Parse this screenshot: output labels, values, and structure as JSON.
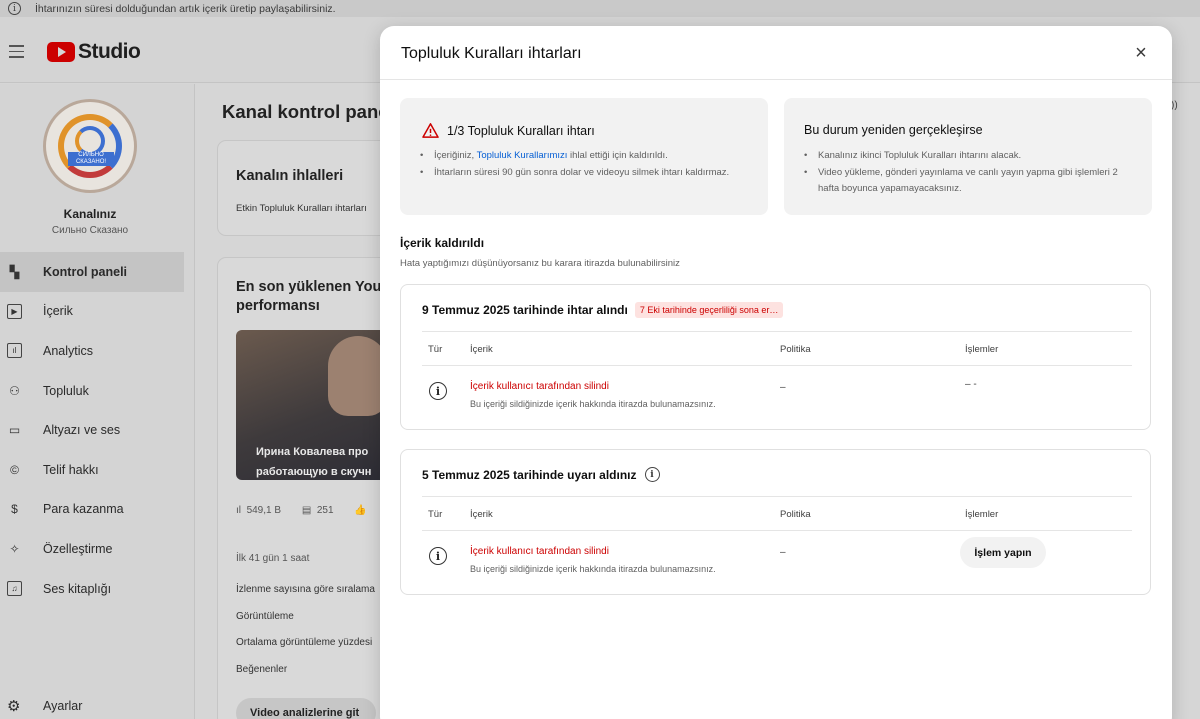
{
  "banner": {
    "info_icon": "i",
    "text": "İhtarınızın süresi dolduğundan artık içerik üretip paylaşabilirsiniz."
  },
  "header": {
    "logo_text": "Studio",
    "brand_color": "#cc0000"
  },
  "channel": {
    "name": "Kanalınız",
    "subtitle": "Сильно Сказано",
    "avatar_text": "СИЛЬНО СКАЗАНО!"
  },
  "sidebar": {
    "items": [
      {
        "label": "Kontrol paneli",
        "icon": "dashboard-icon",
        "glyph": "▚",
        "active": true
      },
      {
        "label": "İçerik",
        "icon": "content-icon",
        "glyph": "▶"
      },
      {
        "label": "Analytics",
        "icon": "analytics-icon",
        "glyph": "ıl"
      },
      {
        "label": "Topluluk",
        "icon": "community-icon",
        "glyph": "⚇"
      },
      {
        "label": "Altyazı ve ses",
        "icon": "subtitles-icon",
        "glyph": "▭"
      },
      {
        "label": "Telif hakkı",
        "icon": "copyright-icon",
        "glyph": "©"
      },
      {
        "label": "Para kazanma",
        "icon": "monetization-icon",
        "glyph": "$"
      },
      {
        "label": "Özelleştirme",
        "icon": "customization-icon",
        "glyph": "✧"
      },
      {
        "label": "Ses kitaplığı",
        "icon": "audio-library-icon",
        "glyph": "♫"
      }
    ],
    "settings": {
      "label": "Ayarlar",
      "icon": "settings-icon",
      "glyph": "⚙"
    }
  },
  "main": {
    "title": "Kanal kontrol paneli",
    "violations_card": {
      "title": "Kanalın ihlalleri",
      "text": "Etkin Topluluk Kuralları ihtarları"
    },
    "latest_card": {
      "title_line1": "En son yüklenen YouTube video",
      "title_line2": "performansı",
      "video_caption_line1": "Ирина Ковалева про",
      "video_caption_line2": "работающую в скучн",
      "stats": {
        "views": "549,1 B",
        "comments": "251"
      },
      "meta": "İlk 41 gün 1 saat",
      "rows": [
        "İzlenme sayısına göre sıralama",
        "Görüntüleme",
        "Ortalama görüntüleme yüzdesi",
        "Beğenenler"
      ],
      "button": "Video analizlerine git"
    }
  },
  "modal": {
    "title": "Topluluk Kuralları ihtarları",
    "close_icon": "×",
    "left_panel": {
      "title": "1/3 Topluluk Kuralları ihtarı",
      "bullet1_pre": "İçeriğiniz, ",
      "bullet1_link": "Topluluk Kurallarımızı",
      "bullet1_post": " ihlal ettiği için kaldırıldı.",
      "bullet2": "İhtarların süresi 90 gün sonra dolar ve videoyu silmek ihtarı kaldırmaz."
    },
    "right_panel": {
      "title": "Bu durum yeniden gerçekleşirse",
      "bullet1": "Kanalınız ikinci Topluluk Kuralları ihtarını alacak.",
      "bullet2": "Video yükleme, gönderi yayınlama ve canlı yayın yapma gibi işlemleri 2 hafta boyunca yapamayacaksınız."
    },
    "section": {
      "title": "İçerik kaldırıldı",
      "subtitle": "Hata yaptığımızı düşünüyorsanız bu karara itirazda bulunabilirsiniz"
    },
    "table_headers": {
      "type": "Tür",
      "content": "İçerik",
      "policy": "Politika",
      "actions": "İşlemler"
    },
    "strikes": [
      {
        "title": "9 Temmuz 2025 tarihinde ihtar alındı",
        "badge": "7 Eki tarihinde geçerliliği sona er…",
        "row": {
          "title": "İçerik kullanıcı tarafından silindi",
          "desc": "Bu içeriği sildiğinizde içerik hakkında itirazda bulunamazsınız.",
          "policy": "–",
          "actions": "– -"
        }
      },
      {
        "title": "5 Temmuz 2025 tarihinde uyarı aldınız",
        "row": {
          "title": "İçerik kullanıcı tarafından silindi",
          "desc": "Bu içeriği sildiğinizde içerik hakkında itirazda bulunamazsınız.",
          "policy": "–",
          "action_button": "İşlem yapın"
        }
      }
    ],
    "colors": {
      "link": "#065fd4",
      "error": "#cc0000",
      "badge_bg": "#fde2e0"
    }
  }
}
